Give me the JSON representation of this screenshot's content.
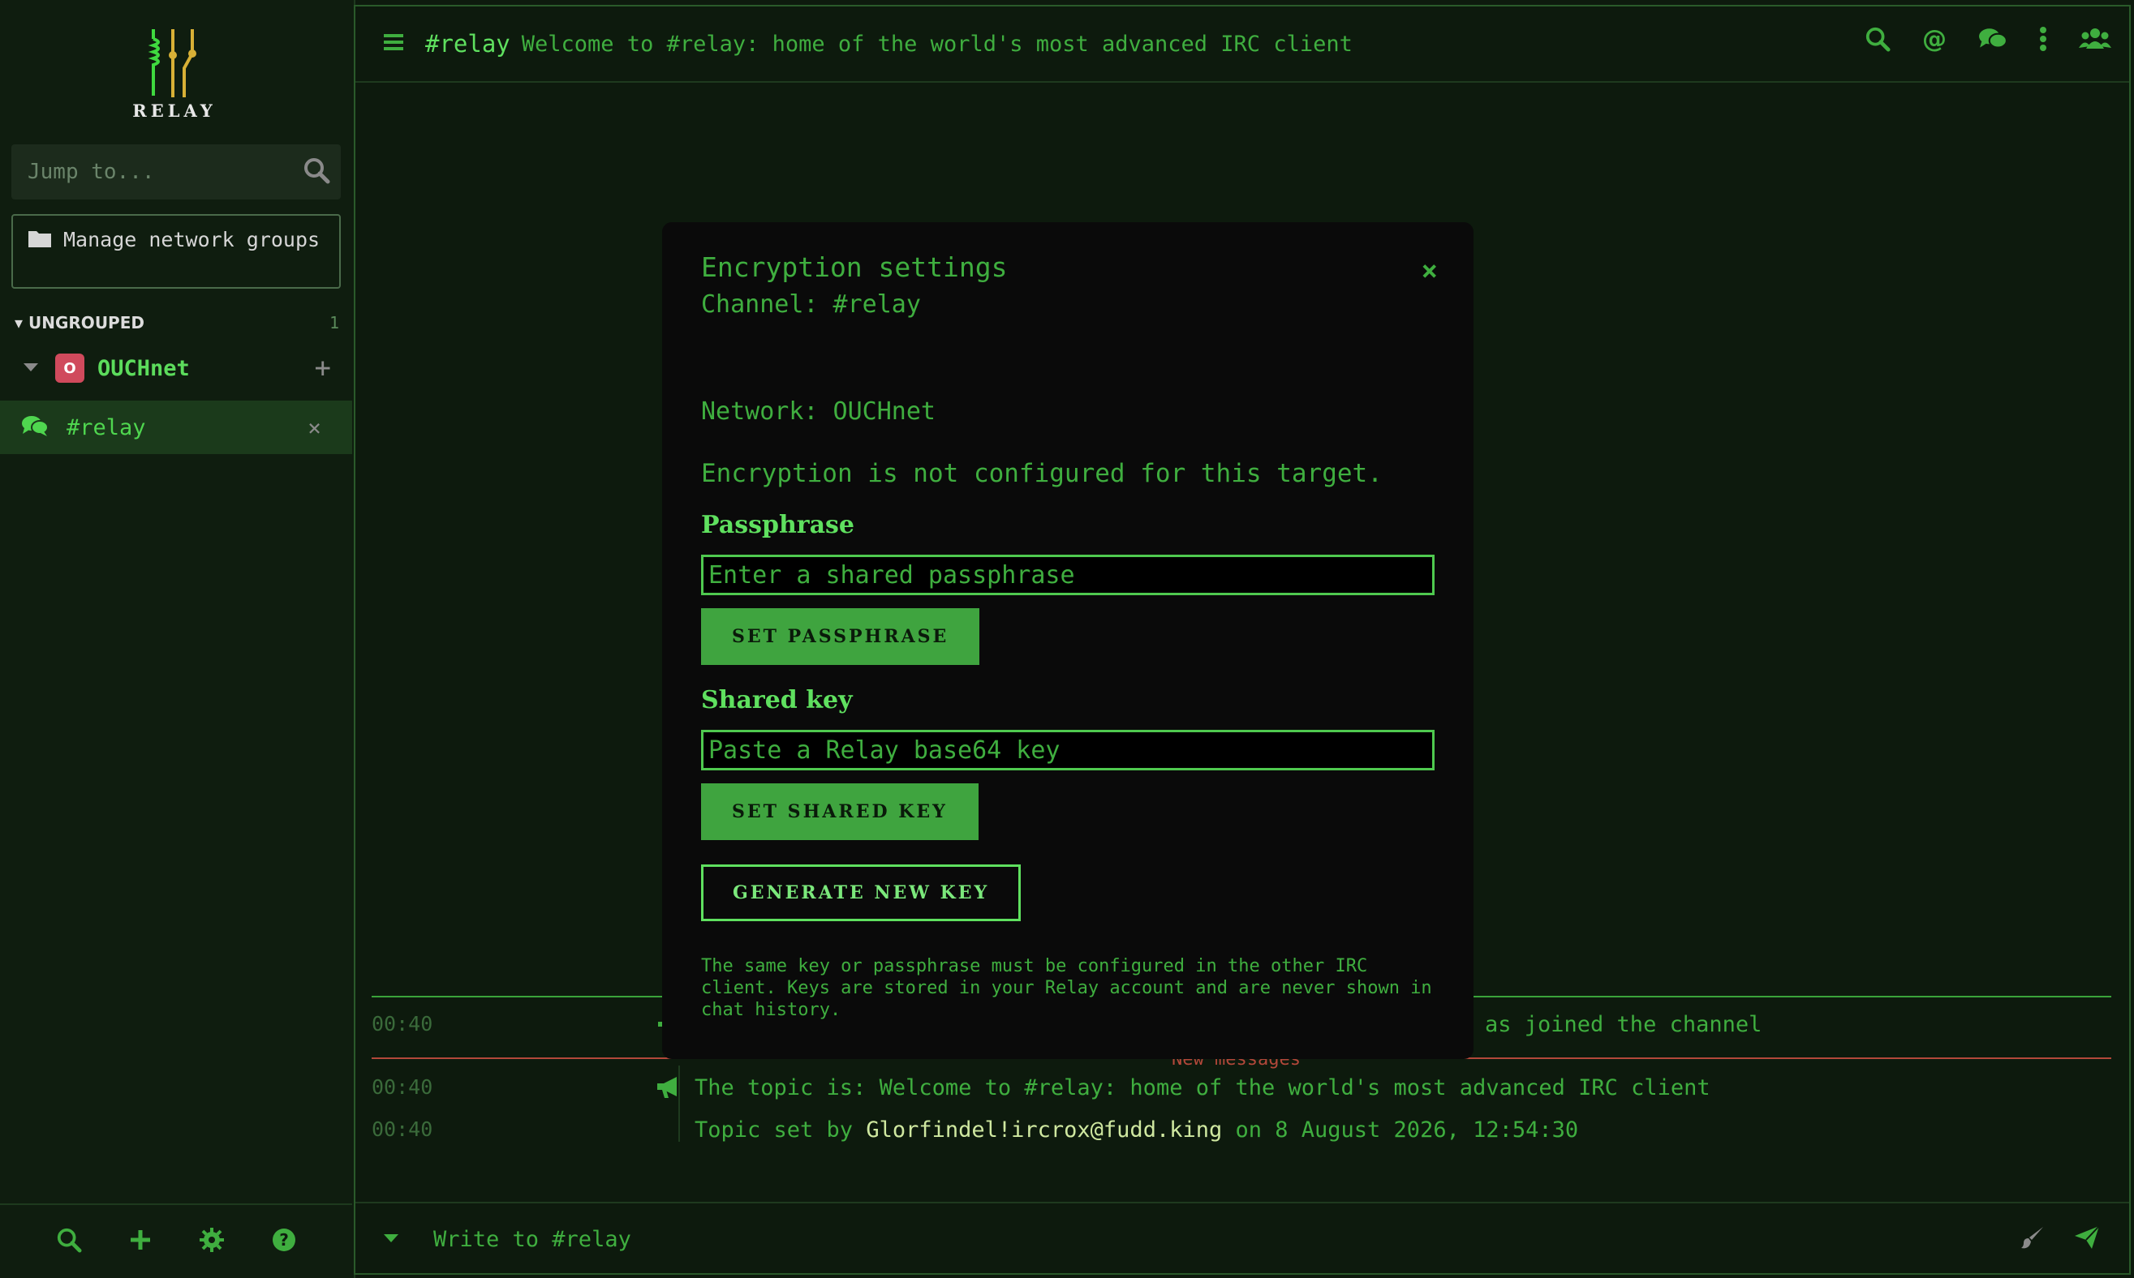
{
  "brand": {
    "name": "RELAY"
  },
  "sidebar": {
    "jump_placeholder": "Jump to...",
    "manage_label": "Manage network groups",
    "group": {
      "name": "UNGROUPED",
      "count": "1"
    },
    "network": {
      "badge": "O",
      "name": "OUCHnet"
    },
    "channel": {
      "name": "#relay"
    },
    "footer_icons": [
      "search-icon",
      "plus-icon",
      "gear-icon",
      "help-icon"
    ]
  },
  "topbar": {
    "channel": "#relay",
    "topic": "Welcome to #relay: home of the world's most advanced IRC client",
    "icons": [
      "search-icon",
      "mention-icon",
      "conversations-icon",
      "more-icon",
      "users-icon"
    ]
  },
  "messages": {
    "new_messages_label": "New messages",
    "rows": [
      {
        "time": "00:40",
        "text": "as joined the channel"
      },
      {
        "time": "00:40",
        "text": "The topic is: Welcome to #relay: home of the world's most advanced IRC client"
      },
      {
        "time": "00:40",
        "prefix": "Topic set by ",
        "nick": "Glorfindel!ircrox@fudd.king",
        "suffix": " on 8 August 2026, 12:54:30"
      }
    ]
  },
  "composer": {
    "placeholder": "Write to #relay"
  },
  "modal": {
    "title": "Encryption settings",
    "channel": "Channel: #relay",
    "network": "Network: OUCHnet",
    "status": "Encryption is not configured for this target.",
    "passphrase_label": "Passphrase",
    "passphrase_placeholder": "Enter a shared passphrase",
    "set_passphrase": "SET PASSPHRASE",
    "shared_key_label": "Shared key",
    "shared_key_placeholder": "Paste a Relay base64 key",
    "set_shared_key": "SET SHARED KEY",
    "generate_key": "GENERATE NEW KEY",
    "note": "The same key or passphrase must be configured in the other IRC client. Keys are stored in your Relay account and are never shown in chat history.",
    "close_label": "×"
  },
  "colors": {
    "accent": "#3fae3f",
    "bright": "#5fe05f",
    "background": "#0d1a0d",
    "modal_bg": "#0a0a0a",
    "badge": "#d04a5c",
    "new_messages": "#b3483a"
  }
}
